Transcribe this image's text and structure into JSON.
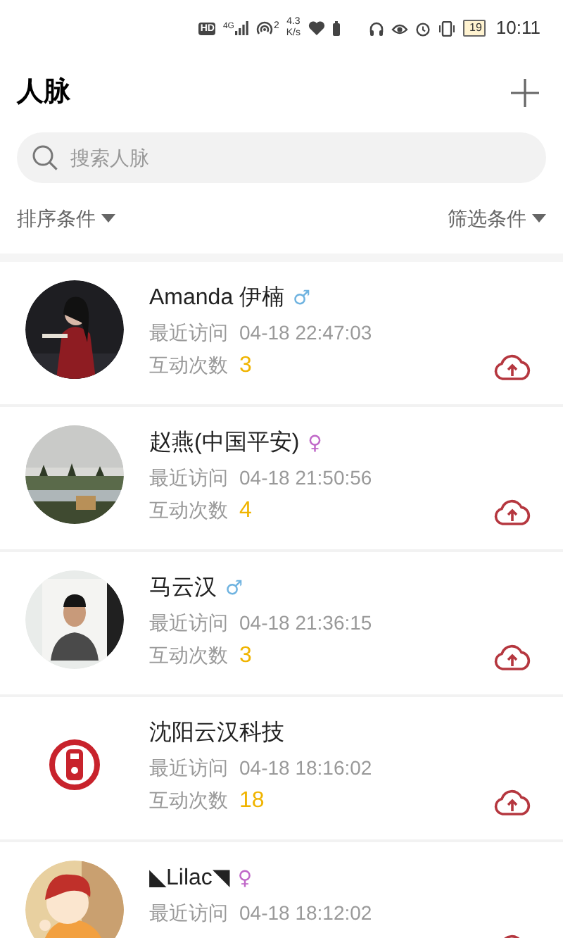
{
  "status_bar": {
    "hd": "HD",
    "network": "4G",
    "hotspot_count": "2",
    "speed_value": "4.3",
    "speed_unit": "K/s",
    "battery": "19",
    "time": "10:11"
  },
  "header": {
    "title": "人脉"
  },
  "search": {
    "placeholder": "搜索人脉"
  },
  "filters": {
    "sort": "排序条件",
    "filter": "筛选条件"
  },
  "contacts": [
    {
      "kind": "picture",
      "name": "Amanda 伊楠",
      "gender_mark": "♂",
      "color": "#6fb3e0",
      "visit_label": "最近访问",
      "visit_time": "04-18 22:47:03",
      "count_label": "互动次数",
      "count": "3"
    },
    {
      "kind": "picture",
      "name": "赵燕(中国平安)",
      "gender_mark": "♀",
      "color": "#c068c8",
      "visit_label": "最近访问",
      "visit_time": "04-18 21:50:56",
      "count_label": "互动次数",
      "count": "4"
    },
    {
      "kind": "picture",
      "name": "马云汉",
      "gender_mark": "♂",
      "color": "#6fb3e0",
      "visit_label": "最近访问",
      "visit_time": "04-18 21:36:15",
      "count_label": "互动次数",
      "count": "3"
    },
    {
      "kind": "logo",
      "name": "沈阳云汉科技",
      "visit_label": "最近访问",
      "visit_time": "04-18 18:16:02",
      "count_label": "互动次数",
      "count": "18"
    },
    {
      "kind": "picture",
      "name": "◣Lilac◥",
      "gender_mark": "♀",
      "color": "#c068c8",
      "visit_label": "最近访问",
      "visit_time": "04-18 18:12:02"
    }
  ]
}
